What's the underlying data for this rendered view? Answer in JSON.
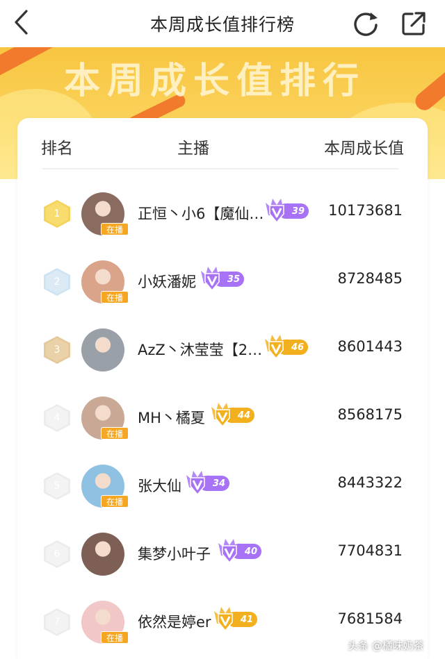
{
  "header": {
    "title": "本周成长值排行榜"
  },
  "banner": {
    "text": "本周成长值排行"
  },
  "table": {
    "columns": {
      "rank": "排名",
      "host": "主播",
      "value": "本周成长值"
    },
    "rows": [
      {
        "rank": "1",
        "name": "正恒丶小6【魔仙…",
        "level": "39",
        "score": "10173681",
        "live": "在播",
        "rank_color": "#f6d35a",
        "rank_inner": "#f8dc70",
        "level_color": "#a772f5",
        "avatar_color": "#8a6b60"
      },
      {
        "rank": "2",
        "name": "小妖潘妮",
        "level": "35",
        "score": "8728485",
        "live": "在播",
        "rank_color": "#cfe4f2",
        "rank_inner": "#dbeaf5",
        "level_color": "#a772f5",
        "avatar_color": "#d9a48a"
      },
      {
        "rank": "3",
        "name": "AzZ丶沐莹莹【2…",
        "level": "46",
        "score": "8601443",
        "live": "",
        "rank_color": "#e5c99b",
        "rank_inner": "#e9d1a8",
        "level_color": "#f2b01e",
        "avatar_color": "#9aa0a8"
      },
      {
        "rank": "4",
        "name": "MH丶橘夏",
        "level": "44",
        "score": "8568175",
        "live": "在播",
        "rank_color": "#ececec",
        "rank_inner": "#f3f3f3",
        "level_color": "#f2b01e",
        "avatar_color": "#c9a996"
      },
      {
        "rank": "5",
        "name": "张大仙",
        "level": "34",
        "score": "8443322",
        "live": "在播",
        "rank_color": "#ececec",
        "rank_inner": "#f3f3f3",
        "level_color": "#a772f5",
        "avatar_color": "#8fc2e2"
      },
      {
        "rank": "6",
        "name": "集梦小叶子",
        "level": "40",
        "score": "7704831",
        "live": "",
        "rank_color": "#ececec",
        "rank_inner": "#f3f3f3",
        "level_color": "#a772f5",
        "avatar_color": "#7d5f55"
      },
      {
        "rank": "7",
        "name": "依然是婷er",
        "level": "41",
        "score": "7681584",
        "live": "在播",
        "rank_color": "#ececec",
        "rank_inner": "#f3f3f3",
        "level_color": "#f2b01e",
        "avatar_color": "#f2c7c7"
      }
    ]
  },
  "watermark": {
    "text": "头条 @橘味奶茶"
  }
}
